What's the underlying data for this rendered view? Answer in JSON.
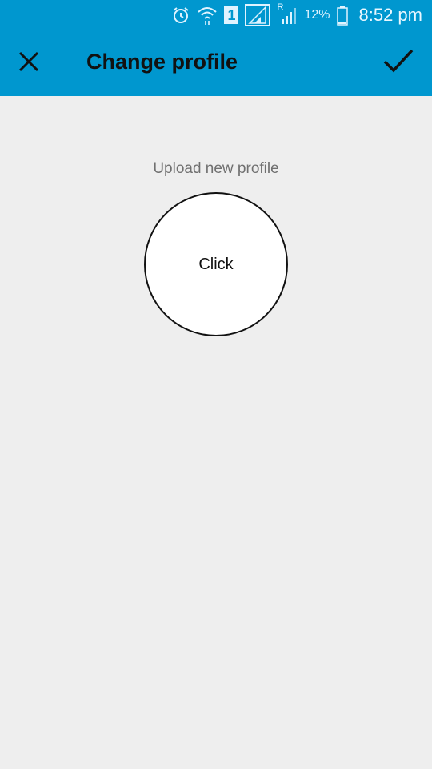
{
  "status_bar": {
    "sim_slot": "1",
    "roaming": "R",
    "battery": "12%",
    "time": "8:52 pm",
    "icons": [
      "alarm-icon",
      "wifi-icon",
      "sim-icon",
      "signal-icon",
      "roaming-signal-icon",
      "battery-icon"
    ]
  },
  "app_bar": {
    "title": "Change profile",
    "close_icon": "close-icon",
    "confirm_icon": "check-icon",
    "background_color": "#0097cf"
  },
  "content": {
    "upload_label": "Upload new profile",
    "avatar_button_label": "Click"
  }
}
